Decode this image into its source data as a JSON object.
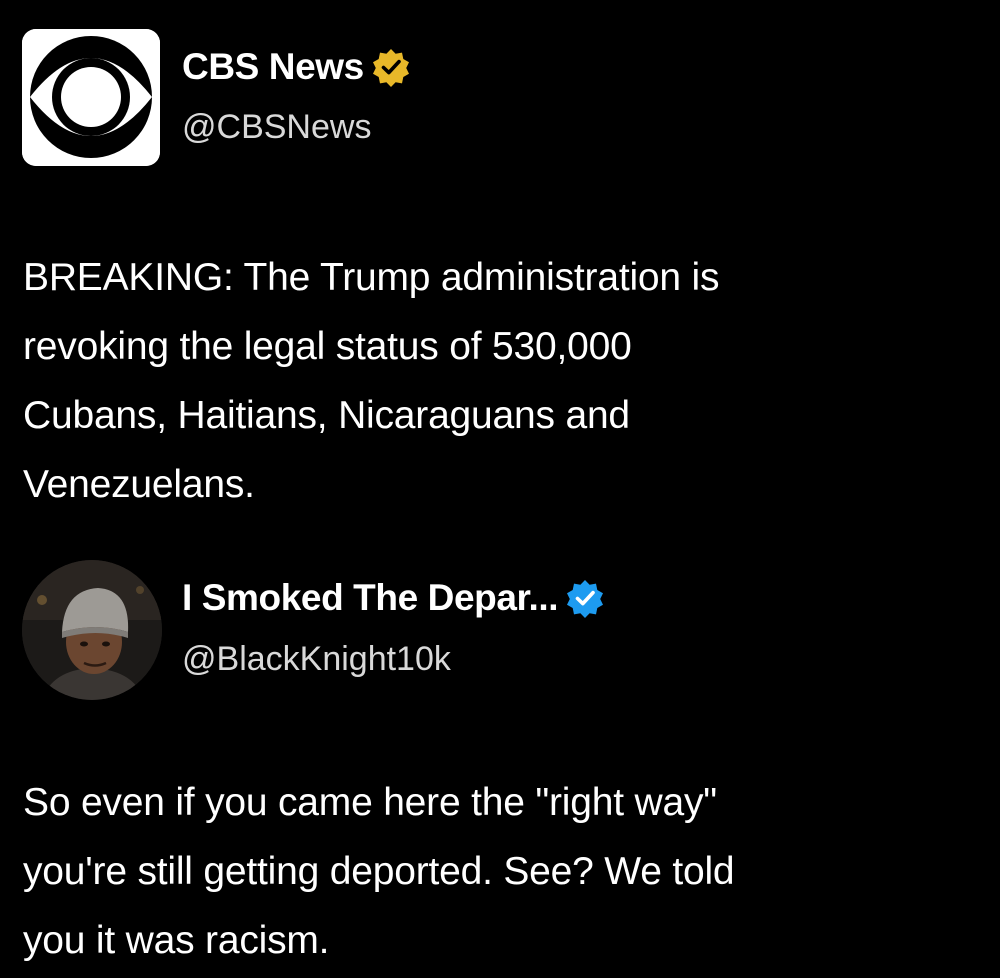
{
  "posts": [
    {
      "author": {
        "display_name": "CBS News",
        "handle": "@CBSNews",
        "verified_badge": "gold-verified-badge-icon",
        "avatar": "cbs-eye-logo"
      },
      "text_lines": [
        "BREAKING: The Trump administration is",
        "revoking the legal status of 530,000",
        "Cubans, Haitians, Nicaraguans and",
        "Venezuelans."
      ]
    },
    {
      "author": {
        "display_name": "I Smoked The Depar...",
        "handle": "@BlackKnight10k",
        "verified_badge": "blue-verified-badge-icon",
        "avatar": "profile-photo-man-in-beanie"
      },
      "text_lines": [
        "So even if you came here the \"right way\"",
        "you're still getting deported. See? We told",
        "you it was racism."
      ]
    }
  ],
  "colors": {
    "background": "#000000",
    "text": "#ffffff",
    "handle": "#d9d9d9",
    "gold_badge": "#e8b829",
    "blue_badge": "#1d9bf0"
  }
}
